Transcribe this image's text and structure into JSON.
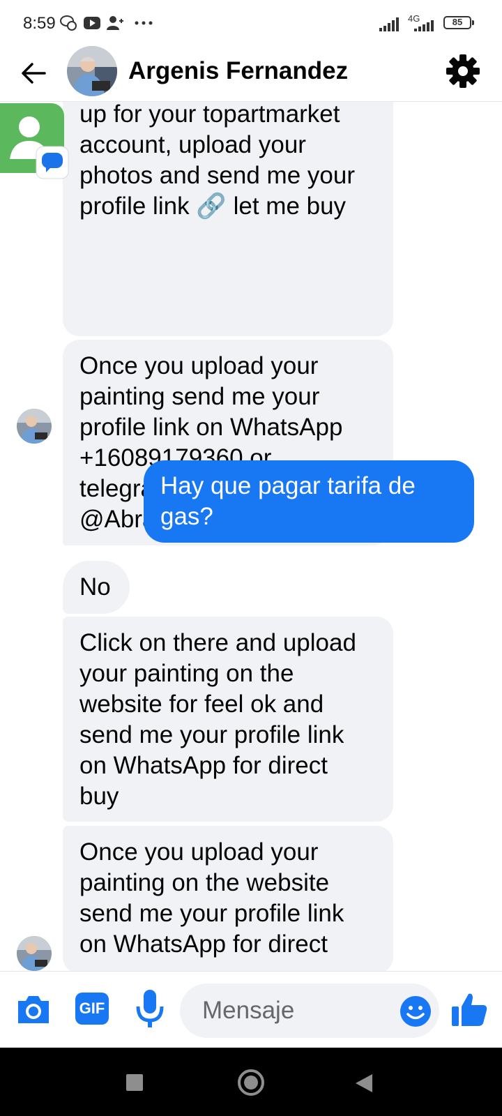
{
  "status_bar": {
    "time": "8:59",
    "network": "4G",
    "battery": "85"
  },
  "header": {
    "contact_name": "Argenis Fernandez",
    "icons": [
      "back-arrow-icon",
      "contact-avatar",
      "gear-icon"
    ]
  },
  "messages": [
    {
      "side": "incoming",
      "text": "up for your topartmarket\naccount, upload your\nphotos and send me your\nprofile link 🔗 let me buy"
    },
    {
      "side": "incoming",
      "text": "Once you upload your\npainting send me your\nprofile link on WhatsApp\n+16089179360 or\ntelegram for direct buy\n@Abraheem_Tayyeh"
    },
    {
      "side": "outgoing",
      "text": "Hay que pagar tarifa de\ngas?"
    },
    {
      "side": "incoming",
      "text": "No"
    },
    {
      "side": "incoming",
      "text": "Click on there and upload\nyour painting on the\nwebsite for feel ok and\nsend me your profile link\non WhatsApp for direct\nbuy"
    },
    {
      "side": "incoming",
      "text": "Once you upload your\npainting on the website\nsend me your profile link\non WhatsApp for direct"
    }
  ],
  "composer": {
    "placeholder": "Mensaje",
    "gif_label": "GIF"
  },
  "colors": {
    "messenger_blue": "#1877f2",
    "incoming_bubble": "#f0f2f5",
    "notification_green": "#5cb85c"
  }
}
